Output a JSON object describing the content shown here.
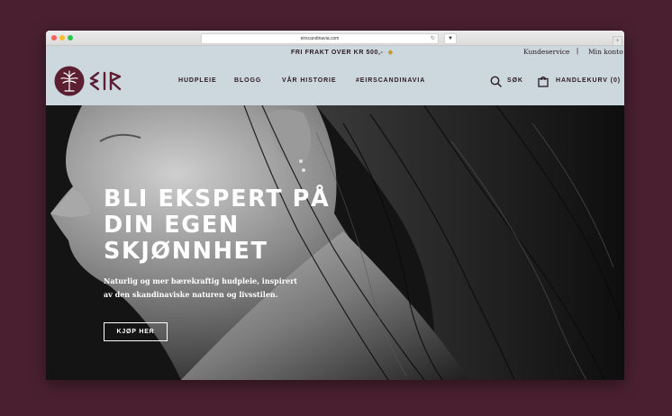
{
  "browser": {
    "url": "eirscandinavia.com"
  },
  "topbar": {
    "promo": "FRI FRAKT OVER KR 500,-",
    "service": "Kundeservice",
    "separator": "|",
    "account": "Min konto"
  },
  "brand": {
    "name": "EIR",
    "color": "#5c1f32"
  },
  "nav": {
    "items": [
      {
        "label": "HUDPLEIE"
      },
      {
        "label": "BLOGG"
      },
      {
        "label": "VÅR HISTORIE"
      },
      {
        "label": "#EIRSCANDINAVIA"
      }
    ],
    "search_label": "SØK",
    "cart_label": "HANDLEKURV (0)"
  },
  "hero": {
    "heading_lines": [
      "BLI EKSPERT PÅ",
      "DIN EGEN",
      "SKJØNNHET"
    ],
    "text": "Naturlig og mer bærekraftig hudpleie, inspirert av den skandinaviske naturen og livsstilen.",
    "cta": "KJØP HER"
  },
  "icons": {
    "search": "search-icon",
    "cart": "shopping-bag-icon",
    "logo": "eir-tree-logo",
    "promo": "gift-icon"
  },
  "colors": {
    "background": "#4a2030",
    "header": "#ccd7de",
    "text": "#2a1a20",
    "hero_text": "#ffffff"
  }
}
